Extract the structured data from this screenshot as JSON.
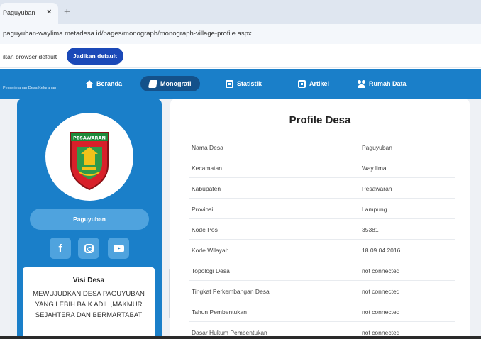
{
  "browser": {
    "tab_title": "Paguyuban",
    "tab_close": "×",
    "new_tab": "+",
    "url": "paguyuban-waylima.metadesa.id/pages/monograph/monograph-village-profile.aspx",
    "infobar_text": "ikan browser default",
    "default_button": "Jadikan default"
  },
  "nav": {
    "brand": "Pemerintahan Desa Kelurahan",
    "items": [
      {
        "label": "Beranda",
        "icon": "home-icon"
      },
      {
        "label": "Monografi",
        "icon": "book-icon"
      },
      {
        "label": "Statistik",
        "icon": "chart-icon"
      },
      {
        "label": "Artikel",
        "icon": "article-icon"
      },
      {
        "label": "Rumah Data",
        "icon": "users-icon"
      }
    ]
  },
  "sidebar": {
    "logo_text": "PESAWARAN",
    "village_name": "Paguyuban",
    "social": [
      "facebook-icon",
      "instagram-icon",
      "youtube-icon"
    ],
    "visi_title": "Visi Desa",
    "visi_text": "MEWUJUDKAN DESA PAGUYUBAN YANG LEBIH BAIK ADIL ,MAKMUR SEJAHTERA DAN BERMARTABAT"
  },
  "profile": {
    "title": "Profile Desa",
    "rows": [
      {
        "label": "Nama Desa",
        "value": "Paguyuban"
      },
      {
        "label": "Kecamatan",
        "value": "Way lima"
      },
      {
        "label": "Kabupaten",
        "value": "Pesawaran"
      },
      {
        "label": "Provinsi",
        "value": "Lampung"
      },
      {
        "label": "Kode Pos",
        "value": "35381"
      },
      {
        "label": "Kode Wilayah",
        "value": "18.09.04.2016"
      },
      {
        "label": "Topologi Desa",
        "value": "not connected"
      },
      {
        "label": "Tingkat Perkembangan Desa",
        "value": "not connected"
      },
      {
        "label": "Tahun Pembentukan",
        "value": "not connected"
      },
      {
        "label": "Dasar Hukum Pembentukan",
        "value": "not connected"
      }
    ]
  },
  "colors": {
    "brand_blue": "#1a7fc9",
    "nav_active": "#14518a",
    "button_blue": "#1b49b8"
  }
}
